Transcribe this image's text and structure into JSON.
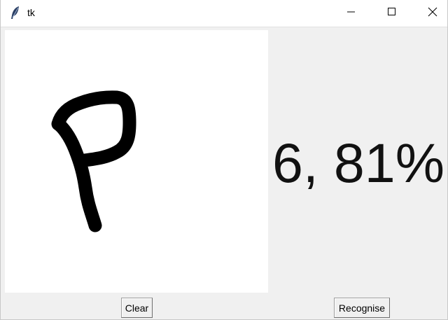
{
  "window": {
    "title": "tk",
    "icons": {
      "app": "feather-icon",
      "minimize": "minimize-icon",
      "maximize": "maximize-icon",
      "close": "close-icon"
    }
  },
  "canvas": {
    "background": "#ffffff",
    "stroke_color": "#000000"
  },
  "result": {
    "text": "6, 81%"
  },
  "buttons": {
    "clear_label": "Clear",
    "recognise_label": "Recognise"
  }
}
